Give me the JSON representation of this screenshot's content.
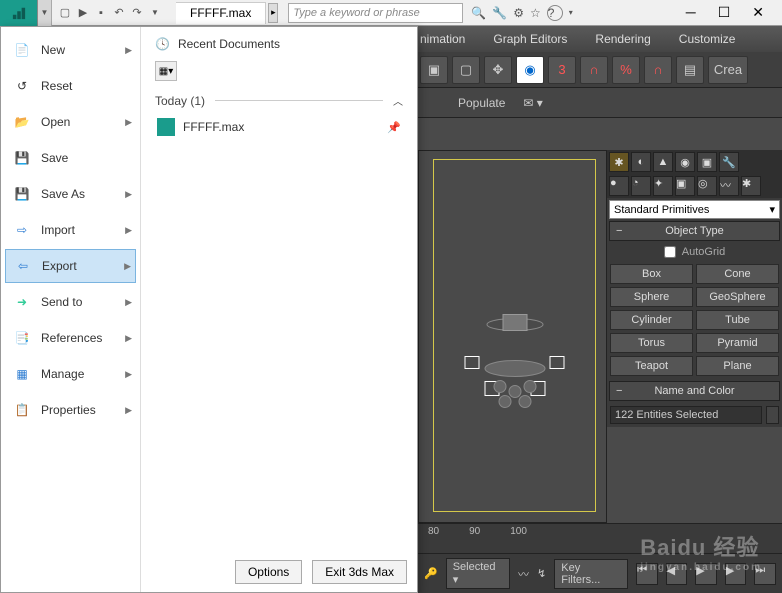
{
  "titlebar": {
    "file_tab": "FFFFF.max",
    "search_placeholder": "Type a keyword or phrase"
  },
  "menubar2": {
    "items": [
      "nimation",
      "Graph Editors",
      "Rendering",
      "Customize"
    ]
  },
  "subbar": {
    "populate": "Populate"
  },
  "app_menu": {
    "items": [
      {
        "label": "New",
        "arrow": true
      },
      {
        "label": "Reset",
        "arrow": false
      },
      {
        "label": "Open",
        "arrow": true
      },
      {
        "label": "Save",
        "arrow": false
      },
      {
        "label": "Save As",
        "arrow": true
      },
      {
        "label": "Import",
        "arrow": true
      },
      {
        "label": "Export",
        "arrow": true,
        "selected": true
      },
      {
        "label": "Send to",
        "arrow": true
      },
      {
        "label": "References",
        "arrow": true
      },
      {
        "label": "Manage",
        "arrow": true
      },
      {
        "label": "Properties",
        "arrow": true
      }
    ],
    "recent_header": "Recent Documents",
    "today_label": "Today (1)",
    "recent_file": "FFFFF.max",
    "footer": {
      "options": "Options",
      "exit": "Exit 3ds Max"
    }
  },
  "right_panel": {
    "dropdown": "Standard Primitives",
    "object_type_label": "Object Type",
    "autogrid_label": "AutoGrid",
    "prims": [
      "Box",
      "Cone",
      "Sphere",
      "GeoSphere",
      "Cylinder",
      "Tube",
      "Torus",
      "Pyramid",
      "Teapot",
      "Plane"
    ],
    "name_color_label": "Name and Color",
    "selection_text": "122 Entities Selected"
  },
  "timeline": {
    "ticks": [
      "80",
      "90",
      "100"
    ]
  },
  "statusbar": {
    "selected": "Selected",
    "key_filters": "Key Filters..."
  },
  "watermark": {
    "main": "Baidu 经验",
    "sub": "jingyan.baidu.com"
  }
}
